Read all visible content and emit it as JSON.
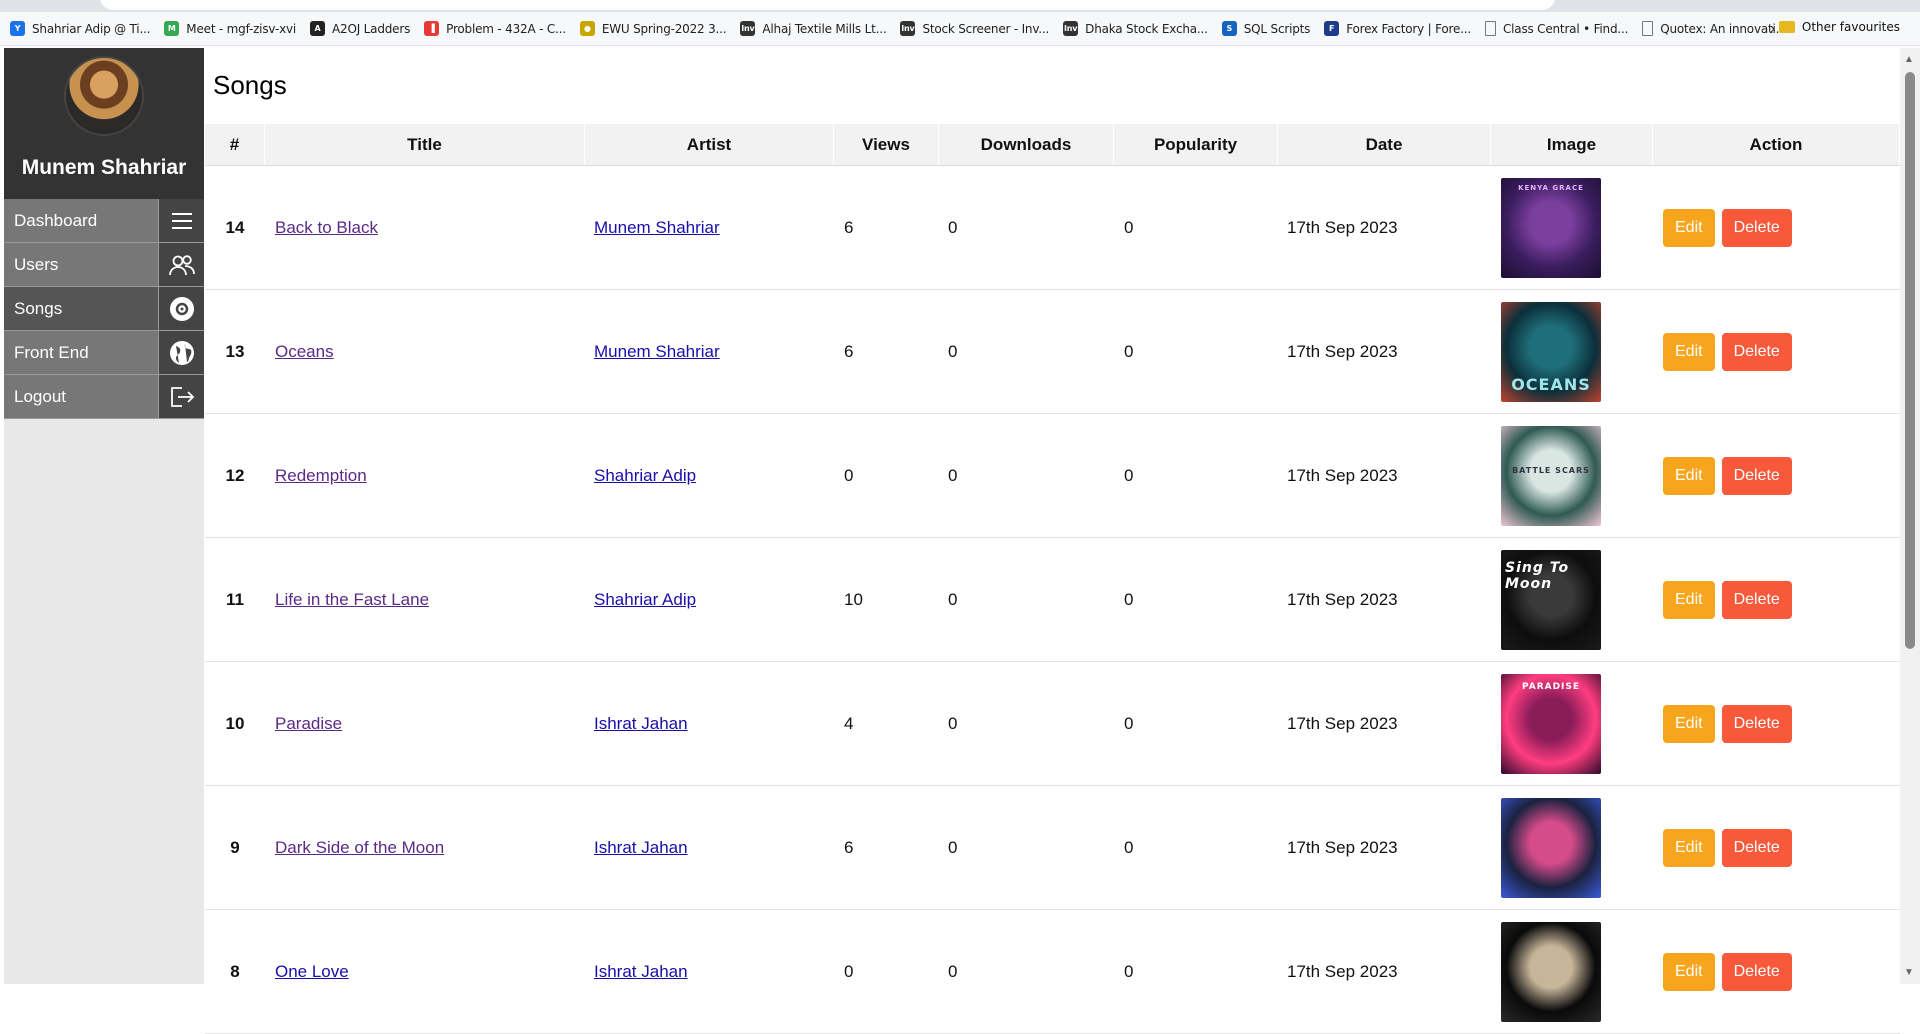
{
  "browser": {
    "bookmarks": [
      {
        "label": "Shahriar Adip @ Ti...",
        "icon": "profile-icon",
        "color": "#1a73e8"
      },
      {
        "label": "Meet - mgf-zisv-xvi",
        "icon": "meet-icon",
        "color": "#34a853"
      },
      {
        "label": "A2OJ Ladders",
        "icon": "a2oj-icon",
        "color": "#222222"
      },
      {
        "label": "Problem - 432A - C...",
        "icon": "codeforces-icon",
        "color": "#e53935"
      },
      {
        "label": "EWU Spring-2022 3...",
        "icon": "ewu-icon",
        "color": "#c6a700"
      },
      {
        "label": "Alhaj Textile Mills Lt...",
        "icon": "investing-icon",
        "color": "#333333"
      },
      {
        "label": "Stock Screener - Inv...",
        "icon": "investing-icon",
        "color": "#333333"
      },
      {
        "label": "Dhaka Stock Excha...",
        "icon": "investing-icon",
        "color": "#333333"
      },
      {
        "label": "SQL Scripts",
        "icon": "sql-icon",
        "color": "#1565c0"
      },
      {
        "label": "Forex Factory | Fore...",
        "icon": "forex-icon",
        "color": "#1e3a8a"
      },
      {
        "label": "Class Central • Find...",
        "icon": "page-icon",
        "color": "#777777"
      },
      {
        "label": "Quotex: An innovati...",
        "icon": "page-icon",
        "color": "#777777"
      }
    ],
    "more_icon": "chevron-right-icon",
    "other_favourites": "Other favourites"
  },
  "sidebar": {
    "user_name": "Munem Shahriar",
    "items": [
      {
        "label": "Dashboard",
        "icon": "menu-icon"
      },
      {
        "label": "Users",
        "icon": "users-icon"
      },
      {
        "label": "Songs",
        "icon": "disc-icon"
      },
      {
        "label": "Front End",
        "icon": "globe-icon"
      },
      {
        "label": "Logout",
        "icon": "logout-icon"
      }
    ]
  },
  "page": {
    "title": "Songs"
  },
  "table": {
    "headers": [
      "#",
      "Title",
      "Artist",
      "Views",
      "Downloads",
      "Popularity",
      "Date",
      "Image",
      "Action"
    ],
    "rows": [
      {
        "num": "14",
        "title": "Back to Black",
        "artist": "Munem Shahriar",
        "views": "6",
        "downloads": "0",
        "popularity": "0",
        "date": "17th Sep 2023",
        "cover_text": "KENYA GRACE",
        "cover_colors": [
          "#3a1d5e",
          "#7b3f9e",
          "#1c1030"
        ]
      },
      {
        "num": "13",
        "title": "Oceans",
        "artist": "Munem Shahriar",
        "views": "6",
        "downloads": "0",
        "popularity": "0",
        "date": "17th Sep 2023",
        "cover_text": "OCEANS",
        "cover_colors": [
          "#0b2f3a",
          "#1f6f7a",
          "#c0432e"
        ]
      },
      {
        "num": "12",
        "title": "Redemption",
        "artist": "Shahriar Adip",
        "views": "0",
        "downloads": "0",
        "popularity": "0",
        "date": "17th Sep 2023",
        "cover_text": "BATTLE SCARS",
        "cover_colors": [
          "#2f5a52",
          "#d9e6e2",
          "#f2c6d6"
        ]
      },
      {
        "num": "11",
        "title": "Life in the Fast Lane",
        "artist": "Shahriar Adip",
        "views": "10",
        "downloads": "0",
        "popularity": "0",
        "date": "17th Sep 2023",
        "cover_text": "Sing To Moon",
        "cover_colors": [
          "#0e0e0e",
          "#3a3a3a",
          "#1a1a1a"
        ]
      },
      {
        "num": "10",
        "title": "Paradise",
        "artist": "Ishrat Jahan",
        "views": "4",
        "downloads": "0",
        "popularity": "0",
        "date": "17th Sep 2023",
        "cover_text": "PARADISE",
        "cover_colors": [
          "#ff3d7f",
          "#8a1c5a",
          "#2b0a2a"
        ]
      },
      {
        "num": "9",
        "title": "Dark Side of the Moon",
        "artist": "Ishrat Jahan",
        "views": "6",
        "downloads": "0",
        "popularity": "0",
        "date": "17th Sep 2023",
        "cover_text": "",
        "cover_colors": [
          "#1b2240",
          "#d64b8a",
          "#3b5bd9"
        ]
      },
      {
        "num": "8",
        "title": "One Love",
        "artist": "Ishrat Jahan",
        "views": "0",
        "downloads": "0",
        "popularity": "0",
        "date": "17th Sep 2023",
        "cover_text": "",
        "cover_colors": [
          "#0a0a0a",
          "#c7b59a",
          "#2a2a2a"
        ]
      }
    ],
    "edit_label": "Edit",
    "delete_label": "Delete",
    "visited_titles": [
      "Back to Black",
      "Oceans",
      "Redemption",
      "Life in the Fast Lane",
      "Paradise",
      "Dark Side of the Moon"
    ]
  },
  "colors": {
    "edit": "#f7a51c",
    "delete": "#f7593a",
    "sidebar_dark": "#333333",
    "nav_item": "#777777"
  }
}
